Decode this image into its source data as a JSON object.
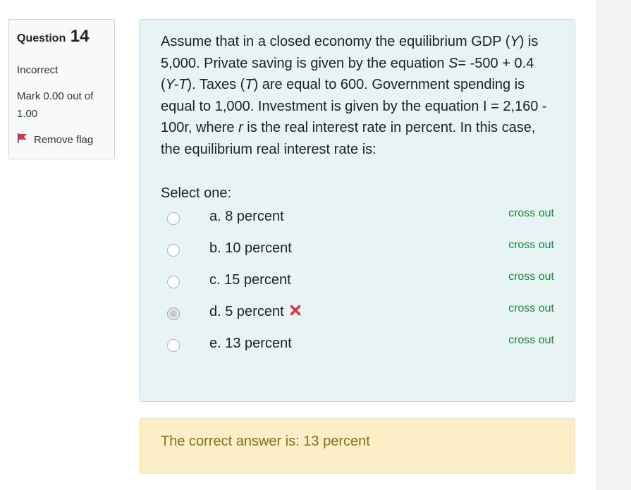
{
  "info": {
    "question_label": "Question",
    "question_number": "14",
    "state": "Incorrect",
    "grade": "Mark 0.00 out of 1.00",
    "flag_label": "Remove flag"
  },
  "question": {
    "text_parts": [
      "Assume that in a closed economy the equilibrium GDP (",
      "Y",
      ") is 5,000. Private saving is given by the equation ",
      "S",
      "= -500 + 0.4 (",
      "Y-T",
      "). Taxes (",
      "T",
      ") are equal to 600. Government spending is equal to 1,000. Investment is given by the equation I = 2,160 - 100r, where ",
      "r",
      " is the real interest rate in percent. In this case, the equilibrium real interest rate is:"
    ],
    "prompt": "Select one:"
  },
  "answers": [
    {
      "label": "a. 8 percent",
      "crossout": "cross out",
      "checked": false,
      "wrong": false
    },
    {
      "label": "b. 10 percent",
      "crossout": "cross out",
      "checked": false,
      "wrong": false
    },
    {
      "label": "c. 15 percent",
      "crossout": "cross out",
      "checked": false,
      "wrong": false
    },
    {
      "label": "d. 5 percent",
      "crossout": "cross out",
      "checked": true,
      "wrong": true
    },
    {
      "label": "e. 13 percent",
      "crossout": "cross out",
      "checked": false,
      "wrong": false
    }
  ],
  "feedback": {
    "text": "The correct answer is: 13 percent"
  },
  "colors": {
    "crossout": "#178a3a",
    "wrong_icon": "#d9364a",
    "flag": "#d9364a",
    "content_bg": "#e7f3f5",
    "feedback_bg": "#fcefc7",
    "feedback_text": "#8a6d1d"
  },
  "icons": {
    "flag": "flag-icon",
    "wrong": "x-mark-icon"
  }
}
